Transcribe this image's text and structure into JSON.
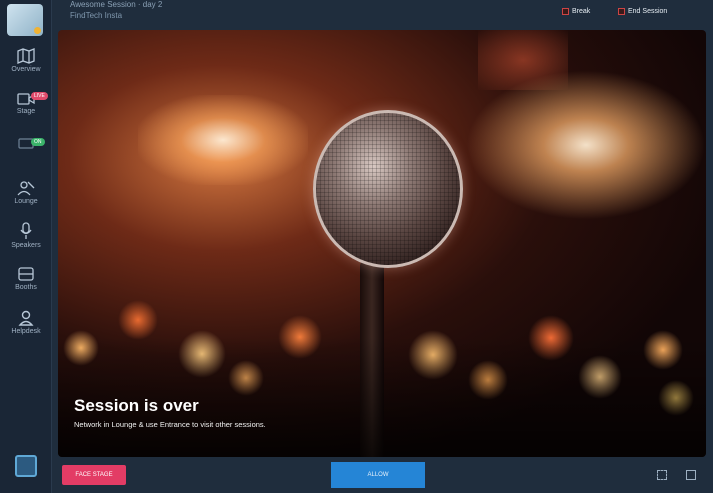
{
  "header": {
    "session_title": "Awesome Session · day 2",
    "session_subtitle": "FindTech Insta",
    "break_label": "Break",
    "end_session_label": "End Session"
  },
  "sidebar": {
    "items": [
      {
        "label": "Overview",
        "icon": "map-icon"
      },
      {
        "label": "Stage",
        "icon": "video-icon",
        "badge": "LIVE"
      },
      {
        "label": "",
        "icon": "screen-icon",
        "badge": "ON"
      },
      {
        "label": "Lounge",
        "icon": "lounge-icon"
      },
      {
        "label": "Speakers",
        "icon": "microphone-icon"
      },
      {
        "label": "Booths",
        "icon": "booth-icon"
      },
      {
        "label": "Helpdesk",
        "icon": "helpdesk-icon"
      }
    ]
  },
  "stage": {
    "title": "Session is over",
    "subtitle": "Network in Lounge & use Entrance to visit other sessions."
  },
  "footer": {
    "left_button": "FACE STAGE",
    "center_button": "ALLOW"
  },
  "colors": {
    "accent_pink": "#e33c65",
    "accent_blue": "#2585d6",
    "sidebar_bg": "#1a2636"
  }
}
